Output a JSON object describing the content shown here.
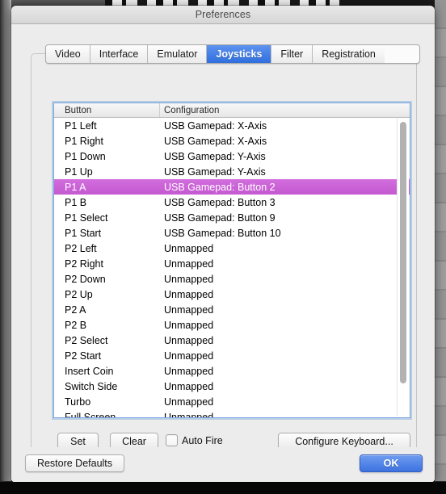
{
  "window": {
    "title": "Preferences"
  },
  "tabs": [
    {
      "label": "Video",
      "selected": false
    },
    {
      "label": "Interface",
      "selected": false
    },
    {
      "label": "Emulator",
      "selected": false
    },
    {
      "label": "Joysticks",
      "selected": true
    },
    {
      "label": "Filter",
      "selected": false
    },
    {
      "label": "Registration",
      "selected": false
    }
  ],
  "table": {
    "columns": [
      "Button",
      "Configuration"
    ],
    "selected_index": 4,
    "rows": [
      {
        "button": "P1 Left",
        "configuration": "USB Gamepad: X-Axis"
      },
      {
        "button": "P1 Right",
        "configuration": "USB Gamepad: X-Axis"
      },
      {
        "button": "P1 Down",
        "configuration": "USB Gamepad: Y-Axis"
      },
      {
        "button": "P1 Up",
        "configuration": "USB Gamepad: Y-Axis"
      },
      {
        "button": "P1 A",
        "configuration": "USB Gamepad: Button 2"
      },
      {
        "button": "P1 B",
        "configuration": "USB Gamepad: Button 3"
      },
      {
        "button": "P1 Select",
        "configuration": "USB Gamepad: Button 9"
      },
      {
        "button": "P1 Start",
        "configuration": "USB Gamepad: Button 10"
      },
      {
        "button": "P2 Left",
        "configuration": "Unmapped"
      },
      {
        "button": "P2 Right",
        "configuration": "Unmapped"
      },
      {
        "button": "P2 Down",
        "configuration": "Unmapped"
      },
      {
        "button": "P2 Up",
        "configuration": "Unmapped"
      },
      {
        "button": "P2 A",
        "configuration": "Unmapped"
      },
      {
        "button": "P2 B",
        "configuration": "Unmapped"
      },
      {
        "button": "P2 Select",
        "configuration": "Unmapped"
      },
      {
        "button": "P2 Start",
        "configuration": "Unmapped"
      },
      {
        "button": "Insert Coin",
        "configuration": "Unmapped"
      },
      {
        "button": "Switch Side",
        "configuration": "Unmapped"
      },
      {
        "button": "Turbo",
        "configuration": "Unmapped"
      },
      {
        "button": "Full Screen",
        "configuration": "Unmapped"
      }
    ]
  },
  "controls": {
    "set_label": "Set",
    "clear_label": "Clear",
    "auto_fire_label": "Auto Fire",
    "auto_fire_checked": false,
    "configure_keyboard_label": "Configure Keyboard..."
  },
  "footer": {
    "restore_defaults_label": "Restore Defaults",
    "ok_label": "OK"
  },
  "colors": {
    "selection": "#c862d4",
    "tab_selected": "#3d72e0",
    "ok_button": "#4b7de6",
    "window_bg": "#ececec"
  }
}
